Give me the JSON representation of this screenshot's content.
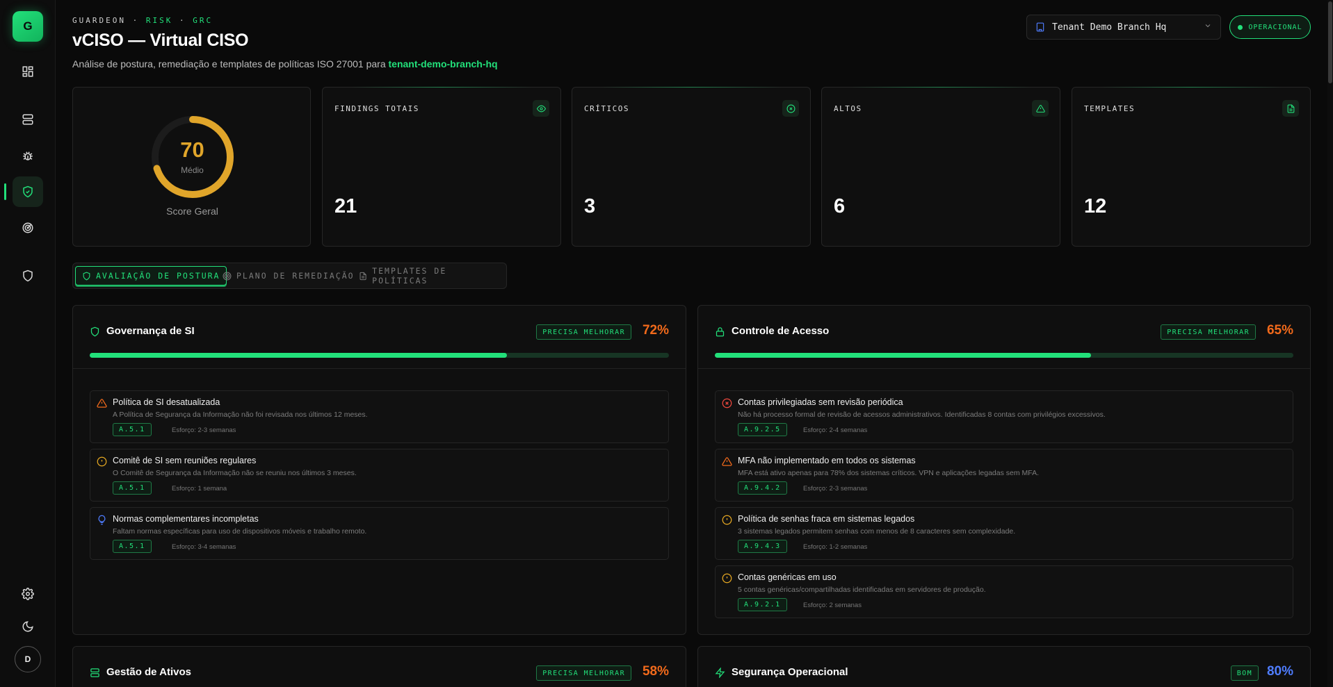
{
  "app": {
    "logo_letter": "G",
    "eyebrow_brand": "GUARDEON",
    "eyebrow_sep": " · ",
    "eyebrow_section1": "RISK",
    "eyebrow_section2": "GRC",
    "avatar_initial": "D"
  },
  "header": {
    "title": "vCISO — Virtual CISO",
    "subtitle_prefix": "Análise de postura, remediação e templates de políticas ISO 27001 para ",
    "tenant_slug": "tenant-demo-branch-hq",
    "tenant_select_value": "Tenant Demo Branch Hq",
    "status": "OPERACIONAL"
  },
  "score": {
    "value": "70",
    "rating": "Médio",
    "caption": "Score Geral",
    "percent": 70,
    "color": "#e0a52a"
  },
  "stats": [
    {
      "label": "FINDINGS TOTAIS",
      "value": "21",
      "icon": "eye-icon"
    },
    {
      "label": "CRÍTICOS",
      "value": "3",
      "icon": "x-circle-icon"
    },
    {
      "label": "ALTOS",
      "value": "6",
      "icon": "alert-triangle-icon"
    },
    {
      "label": "TEMPLATES",
      "value": "12",
      "icon": "file-text-icon"
    }
  ],
  "tabs": [
    {
      "label": "AVALIAÇÃO DE POSTURA",
      "active": true
    },
    {
      "label": "PLANO DE REMEDIAÇÃO",
      "active": false
    },
    {
      "label": "TEMPLATES DE POLÍTICAS",
      "active": false
    }
  ],
  "categories": [
    {
      "title": "Governança de SI",
      "badge": "PRECISA MELHORAR",
      "pct_label": "72%",
      "pct": 72,
      "findings": [
        {
          "severity": "high",
          "title": "Política de SI desatualizada",
          "desc": "A Política de Segurança da Informação não foi revisada nos últimos 12 meses.",
          "code": "A.5.1",
          "effort": "Esforço: 2-3 semanas"
        },
        {
          "severity": "medium",
          "title": "Comitê de SI sem reuniões regulares",
          "desc": "O Comitê de Segurança da Informação não se reuniu nos últimos 3 meses.",
          "code": "A.5.1",
          "effort": "Esforço: 1 semana"
        },
        {
          "severity": "info",
          "title": "Normas complementares incompletas",
          "desc": "Faltam normas específicas para uso de dispositivos móveis e trabalho remoto.",
          "code": "A.5.1",
          "effort": "Esforço: 3-4 semanas"
        }
      ]
    },
    {
      "title": "Controle de Acesso",
      "badge": "PRECISA MELHORAR",
      "pct_label": "65%",
      "pct": 65,
      "findings": [
        {
          "severity": "critical",
          "title": "Contas privilegiadas sem revisão periódica",
          "desc": "Não há processo formal de revisão de acessos administrativos. Identificadas 8 contas com privilégios excessivos.",
          "code": "A.9.2.5",
          "effort": "Esforço: 2-4 semanas"
        },
        {
          "severity": "high",
          "title": "MFA não implementado em todos os sistemas",
          "desc": "MFA está ativo apenas para 78% dos sistemas críticos. VPN e aplicações legadas sem MFA.",
          "code": "A.9.4.2",
          "effort": "Esforço: 2-3 semanas"
        },
        {
          "severity": "medium",
          "title": "Política de senhas fraca em sistemas legados",
          "desc": "3 sistemas legados permitem senhas com menos de 8 caracteres sem complexidade.",
          "code": "A.9.4.3",
          "effort": "Esforço: 1-2 semanas"
        },
        {
          "severity": "medium",
          "title": "Contas genéricas em uso",
          "desc": "5 contas genéricas/compartilhadas identificadas em servidores de produção.",
          "code": "A.9.2.1",
          "effort": "Esforço: 2 semanas"
        }
      ]
    },
    {
      "title": "Gestão de Ativos",
      "badge": "PRECISA MELHORAR",
      "pct_label": "58%",
      "pct": 58,
      "findings": []
    },
    {
      "title": "Segurança Operacional",
      "badge": "BOM",
      "pct_label": "80%",
      "pct": 80,
      "findings": []
    }
  ],
  "colors": {
    "accent": "#22e07a",
    "critical": "#f0483e",
    "high": "#f26a1b",
    "medium": "#e6a822",
    "info": "#4f7dff"
  }
}
